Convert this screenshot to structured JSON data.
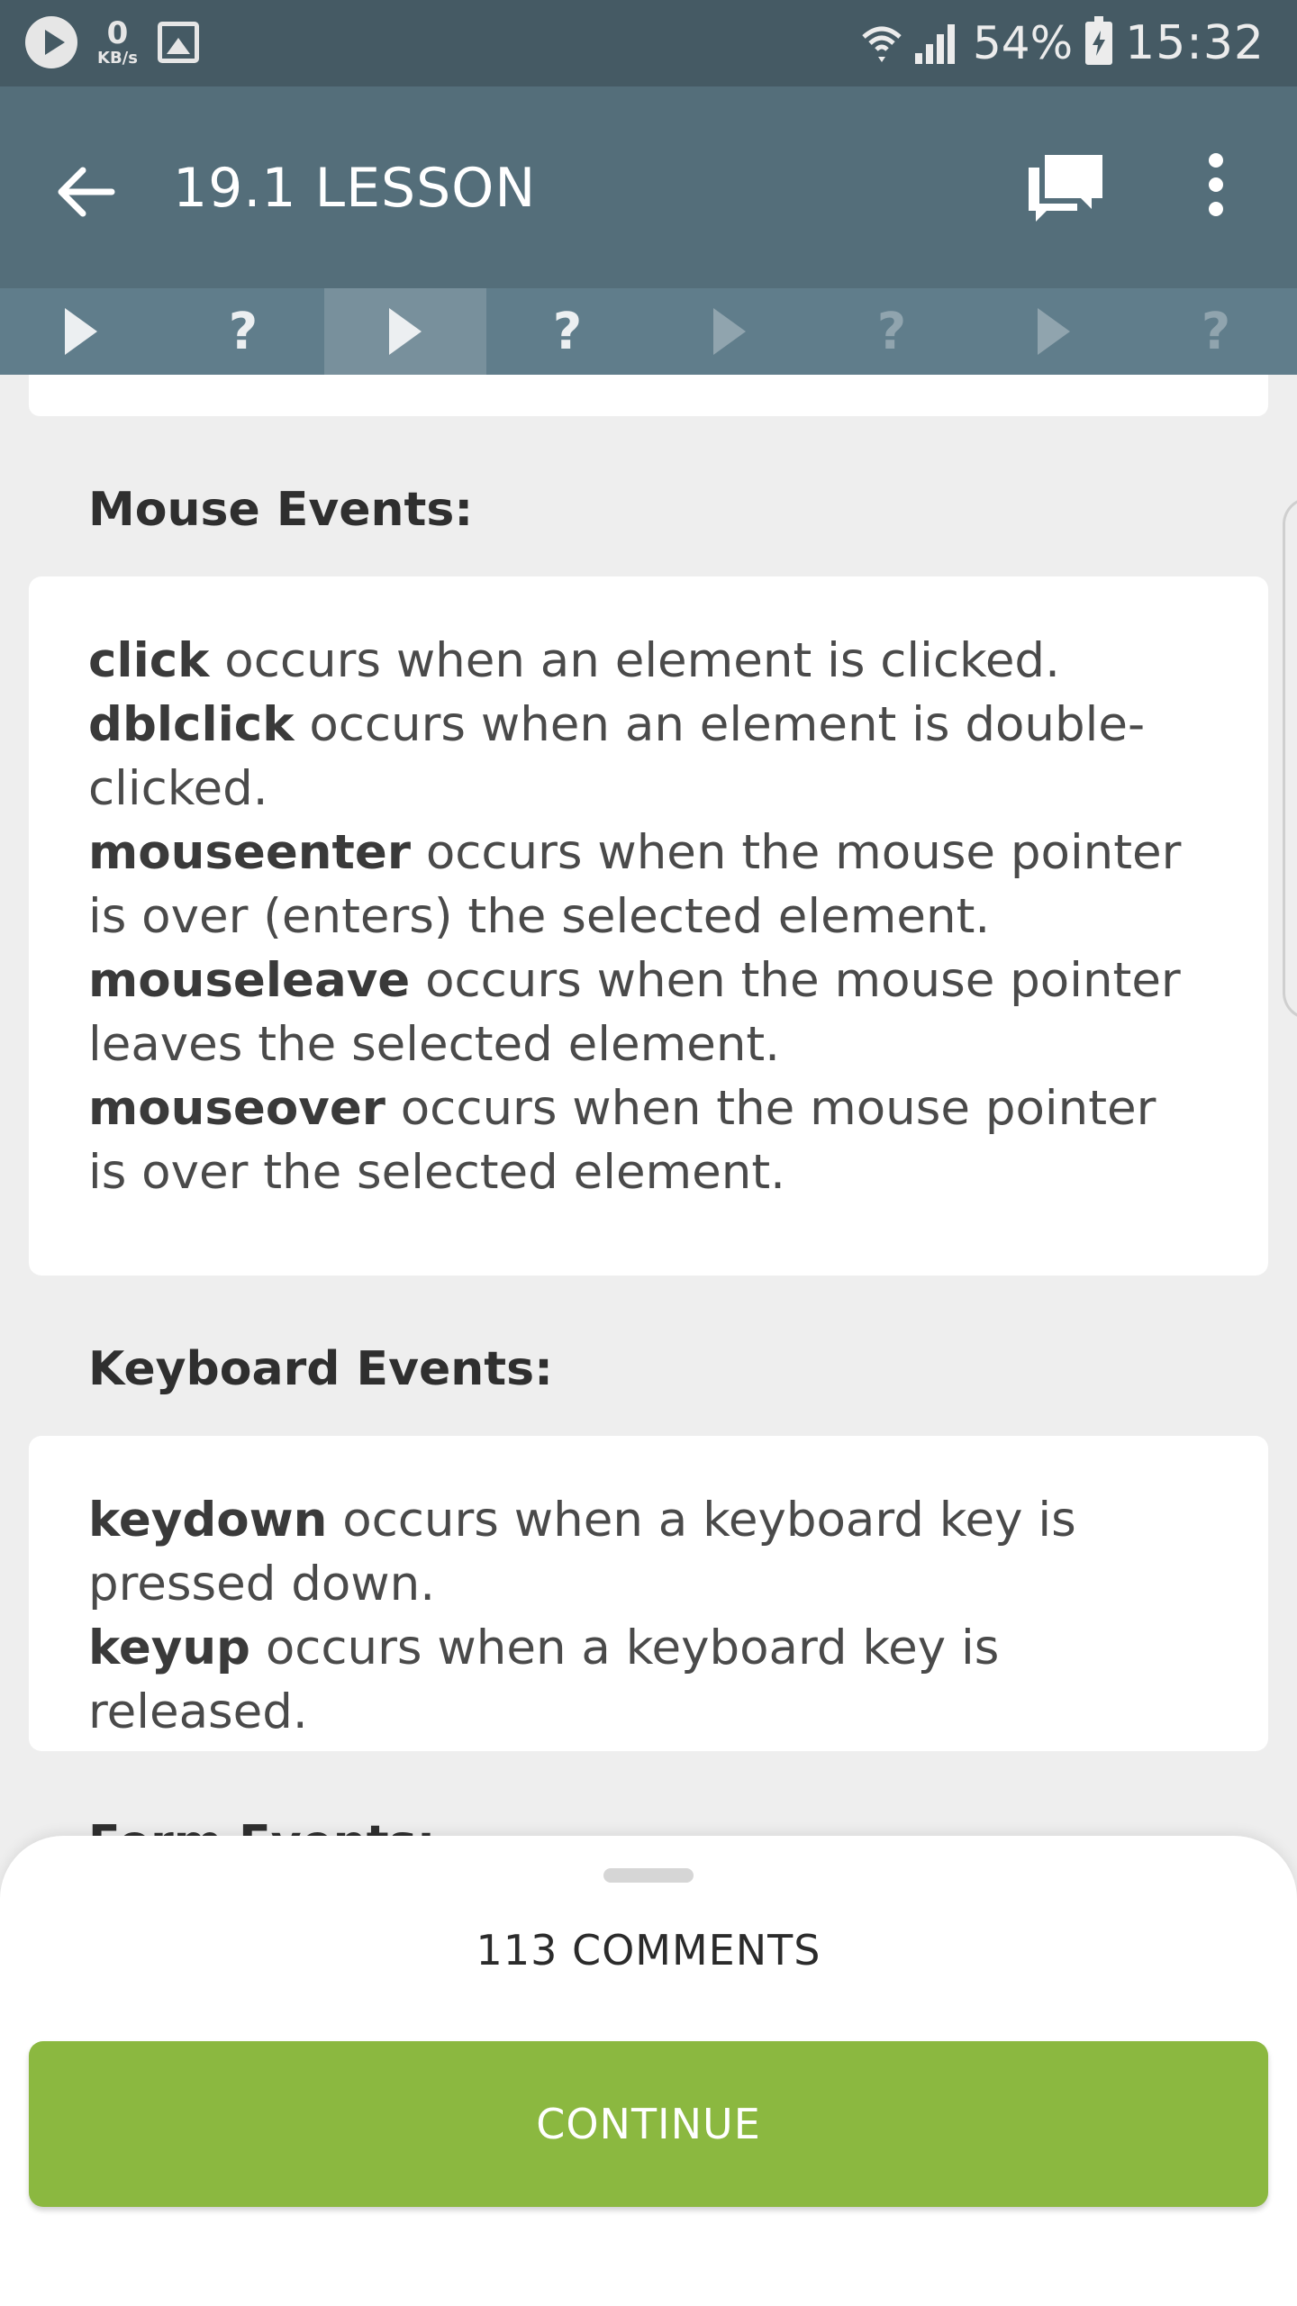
{
  "status_bar": {
    "net_speed_value": "0",
    "net_speed_unit": "KB/s",
    "battery": "54%",
    "time": "15:32"
  },
  "app_bar": {
    "title": "19.1 LESSON"
  },
  "steps": [
    {
      "type": "play",
      "state": "done"
    },
    {
      "type": "quiz",
      "label": "?",
      "state": "done"
    },
    {
      "type": "play",
      "state": "active"
    },
    {
      "type": "quiz",
      "label": "?",
      "state": "done"
    },
    {
      "type": "play",
      "state": "locked"
    },
    {
      "type": "quiz",
      "label": "?",
      "state": "locked"
    },
    {
      "type": "play",
      "state": "locked"
    },
    {
      "type": "quiz",
      "label": "?",
      "state": "locked"
    }
  ],
  "content": {
    "mouse_title": "Mouse Events:",
    "mouse_events": [
      {
        "name": "click",
        "desc": " occurs when an element is clicked."
      },
      {
        "name": "dblclick",
        "desc": " occurs when an element is double-clicked."
      },
      {
        "name": "mouseenter",
        "desc": " occurs when the mouse pointer is over (enters) the selected element."
      },
      {
        "name": "mouseleave",
        "desc": " occurs when the mouse pointer leaves the selected element."
      },
      {
        "name": "mouseover",
        "desc": " occurs when the mouse pointer is over the selected element."
      }
    ],
    "keyboard_title": "Keyboard Events:",
    "keyboard_events": [
      {
        "name": "keydown",
        "desc": " occurs when a keyboard key is pressed down."
      },
      {
        "name": "keyup",
        "desc": " occurs when a keyboard key is released."
      }
    ],
    "form_title": "Form Events:"
  },
  "bottom_sheet": {
    "comments_label": "113 COMMENTS",
    "continue_label": "CONTINUE"
  },
  "colors": {
    "status_bar": "#455a64",
    "app_bar": "#546e7a",
    "step_bar": "#607d8b",
    "continue": "#8bb840"
  }
}
